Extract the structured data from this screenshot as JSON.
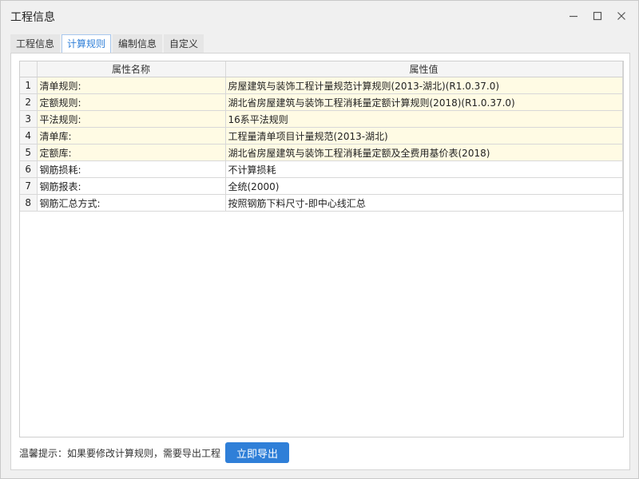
{
  "window": {
    "title": "工程信息",
    "buttons": {
      "minimize_icon": "—",
      "maximize_icon": "☐",
      "close_icon": "✕"
    }
  },
  "tabs": [
    {
      "label": "工程信息",
      "active": false
    },
    {
      "label": "计算规则",
      "active": true
    },
    {
      "label": "编制信息",
      "active": false
    },
    {
      "label": "自定义",
      "active": false
    }
  ],
  "table": {
    "columns": [
      "",
      "属性名称",
      "属性值"
    ],
    "rows": [
      {
        "index": "1",
        "name": "清单规则:",
        "value": "房屋建筑与装饰工程计量规范计算规则(2013-湖北)(R1.0.37.0)",
        "highlight": true
      },
      {
        "index": "2",
        "name": "定额规则:",
        "value": "湖北省房屋建筑与装饰工程消耗量定额计算规则(2018)(R1.0.37.0)",
        "highlight": true
      },
      {
        "index": "3",
        "name": "平法规则:",
        "value": "16系平法规则",
        "highlight": true
      },
      {
        "index": "4",
        "name": "清单库:",
        "value": "工程量清单项目计量规范(2013-湖北)",
        "highlight": true
      },
      {
        "index": "5",
        "name": "定额库:",
        "value": "湖北省房屋建筑与装饰工程消耗量定额及全费用基价表(2018)",
        "highlight": true
      },
      {
        "index": "6",
        "name": "钢筋损耗:",
        "value": "不计算损耗",
        "highlight": false
      },
      {
        "index": "7",
        "name": "钢筋报表:",
        "value": "全统(2000)",
        "highlight": false
      },
      {
        "index": "8",
        "name": "钢筋汇总方式:",
        "value": "按照钢筋下料尺寸-即中心线汇总",
        "highlight": false
      }
    ]
  },
  "footer": {
    "hint": "温馨提示：如果要修改计算规则，需要导出工程",
    "export_label": "立即导出"
  },
  "colors": {
    "accent": "#2f7fd8",
    "highlight_row": "#fffbe4"
  }
}
